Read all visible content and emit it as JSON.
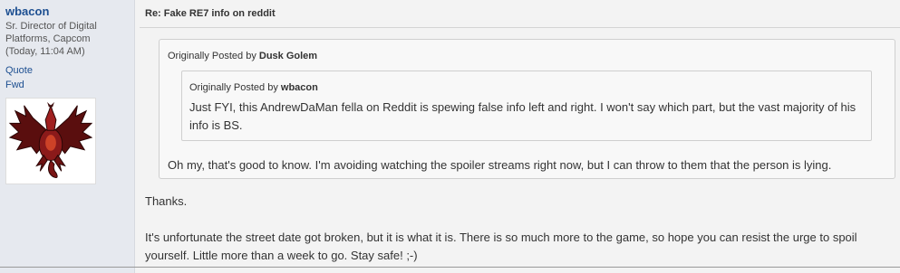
{
  "sidebar": {
    "username": "wbacon",
    "title_line1": "Sr. Director of Digital",
    "title_line2": "Platforms, Capcom",
    "post_time": "(Today, 11:04 AM)",
    "quote_link": "Quote",
    "fwd_link": "Fwd",
    "avatar_icon": "red-dragon-emblem-icon"
  },
  "post": {
    "title": "Re: Fake RE7 info on reddit",
    "outer_quote": {
      "prefix": "Originally Posted by",
      "author": "Dusk Golem",
      "text": "Oh my, that's good to know. I'm avoiding watching the spoiler streams right now, but I can throw to them that the person is lying."
    },
    "inner_quote": {
      "prefix": "Originally Posted by",
      "author": "wbacon",
      "text": "Just FYI, this AndrewDaMan fella on Reddit is spewing false info left and right. I won't say which part, but the vast majority of his info is BS."
    },
    "reply_line1": "Thanks.",
    "reply_line2": "It's unfortunate the street date got broken, but it is what it is. There is so much more to the game, so hope you can resist the urge to spoil yourself. Little more than a week to go. Stay safe! ;-)"
  },
  "colors": {
    "sidebar_bg": "#e6e9ef",
    "page_bg": "#f3f3f3",
    "link": "#1d4f91",
    "quote_border": "#cfcfcf",
    "dragon_red": "#8b1a1a"
  }
}
